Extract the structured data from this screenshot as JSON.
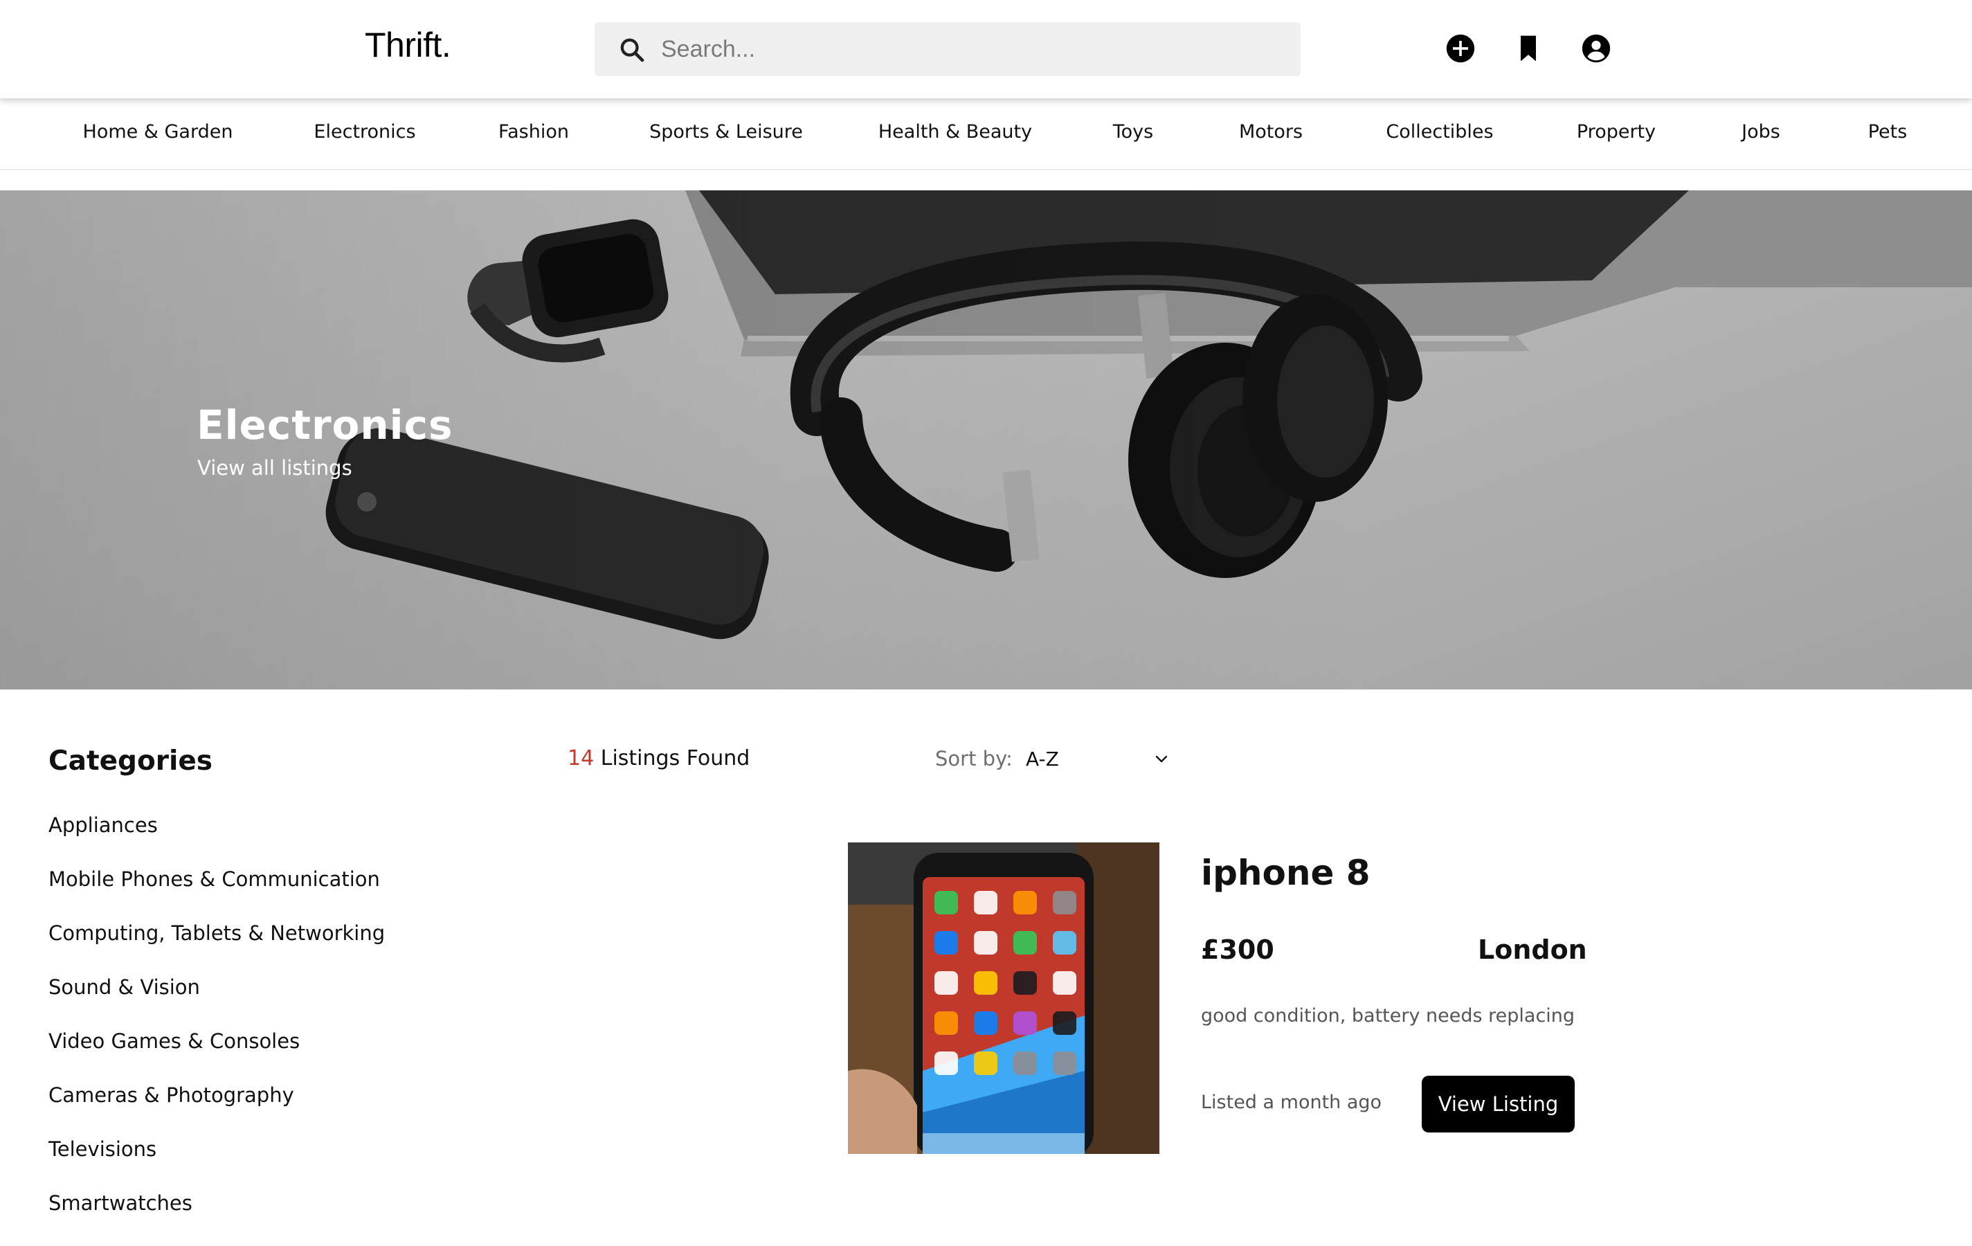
{
  "header": {
    "logo": "Thrift.",
    "search": {
      "placeholder": "Search...",
      "value": ""
    },
    "icons": [
      "add-circle-icon",
      "bookmark-icon",
      "account-icon"
    ]
  },
  "nav": {
    "items": [
      {
        "label": "Home & Garden"
      },
      {
        "label": "Electronics"
      },
      {
        "label": "Fashion"
      },
      {
        "label": "Sports & Leisure"
      },
      {
        "label": "Health & Beauty"
      },
      {
        "label": "Toys"
      },
      {
        "label": "Motors"
      },
      {
        "label": "Collectibles"
      },
      {
        "label": "Property"
      },
      {
        "label": "Jobs"
      },
      {
        "label": "Pets"
      }
    ]
  },
  "hero": {
    "title": "Electronics",
    "link": "View all listings"
  },
  "sidebar": {
    "heading": "Categories",
    "items": [
      {
        "label": "Appliances"
      },
      {
        "label": "Mobile Phones & Communication"
      },
      {
        "label": "Computing, Tablets & Networking"
      },
      {
        "label": "Sound & Vision"
      },
      {
        "label": "Video Games & Consoles"
      },
      {
        "label": "Cameras & Photography"
      },
      {
        "label": "Televisions"
      },
      {
        "label": "Smartwatches"
      }
    ]
  },
  "results": {
    "count": "14",
    "label": "Listings Found",
    "sort_label": "Sort by:",
    "sort_value": "A-Z"
  },
  "listing": {
    "title": "iphone 8",
    "price": "£300",
    "location": "London",
    "description": "good condition, battery needs replacing",
    "listed": "Listed a month ago",
    "button": "View Listing"
  },
  "colors": {
    "accent": "#000000",
    "count": "#c0392b",
    "search_bg": "#f0f0f0"
  }
}
